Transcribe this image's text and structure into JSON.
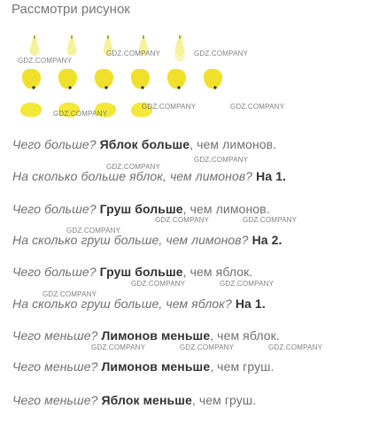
{
  "title": "Рассмотри рисунок",
  "watermark": "GDZ.COMPANY",
  "colors": {
    "pear_yellow": "#f7ef8a",
    "pear_stem": "#a2b31e",
    "apple_yellow": "#f0e02b",
    "lemon_yellow": "#f3e838",
    "seed_dark": "#2a2a1a"
  },
  "qa": [
    {
      "q": "Чего больше?",
      "a": "Яблок больше",
      "rest": ", чем лимонов."
    },
    {
      "q": "На сколько больше яблок, чем лимонов?",
      "a": "На 1.",
      "rest": ""
    },
    {
      "q": "Чего больше?",
      "a": "Груш больше",
      "rest": ", чем лимонов."
    },
    {
      "q": "На сколько груш больше, чем лимонов?",
      "a": "На 2.",
      "rest": ""
    },
    {
      "q": "Чего больше?",
      "a": "Груш больше",
      "rest": ", чем яблок."
    },
    {
      "q": "На сколько груш больше, чем яблок?",
      "a": "На 1.",
      "rest": ""
    },
    {
      "q": "Чего меньше?",
      "a": "Лимонов меньше",
      "rest": ", чем яблок."
    },
    {
      "q": "Чего меньше?",
      "a": "Лимонов меньше",
      "rest": ", чем груш."
    },
    {
      "q": "Чего меньше?",
      "a": "Яблок меньше",
      "rest": ", чем груш."
    }
  ]
}
